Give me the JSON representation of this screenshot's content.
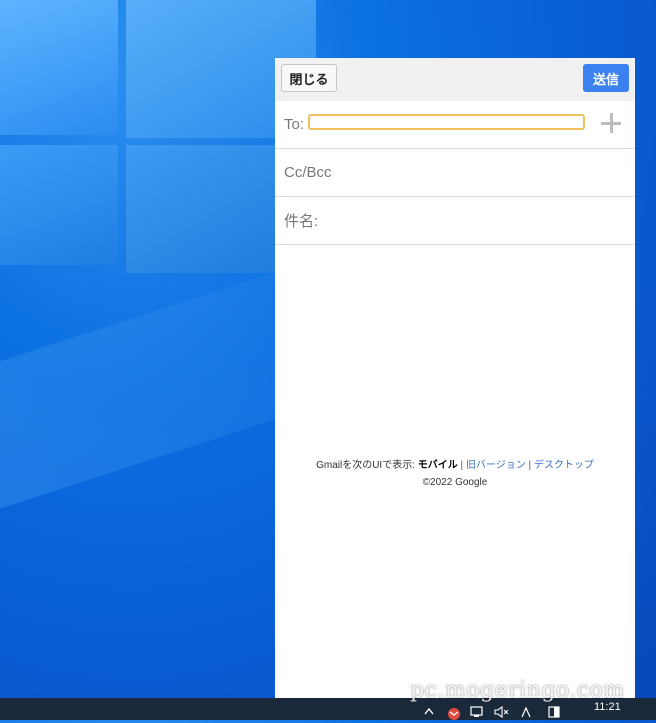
{
  "compose": {
    "close_label": "閉じる",
    "send_label": "送信",
    "to_label": "To:",
    "to_value": "",
    "ccbcc_label": "Cc/Bcc",
    "subject_label": "件名:"
  },
  "footer": {
    "prefix": "Gmailを次のUIで表示: ",
    "mobile": "モバイル",
    "sep1": " | ",
    "old_version": "旧バージョン",
    "sep2": " | ",
    "desktop": "デスクトップ",
    "copyright": "©2022 Google"
  },
  "taskbar": {
    "time": "11:21"
  },
  "watermark": "pc.mogeringo.com",
  "colors": {
    "send_button": "#3b82f0",
    "to_border": "#f2c15e",
    "link": "#3b6fc4"
  },
  "icons": [
    "plus-icon",
    "chevron-up-icon",
    "gmail-icon",
    "network-icon",
    "volume-muted-icon",
    "ime-icon",
    "notification-icon"
  ]
}
